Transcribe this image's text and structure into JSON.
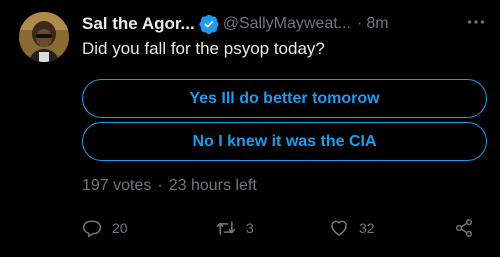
{
  "tweet": {
    "author_name": "Sal the Agor...",
    "handle": "@SallyMayweat...",
    "separator": "·",
    "time": "8m",
    "text": "Did you fall for the psyop today?"
  },
  "poll": {
    "options": [
      {
        "label": "Yes Ill do better tomorow"
      },
      {
        "label": "No I knew it was the CIA"
      }
    ],
    "votes": "197 votes",
    "separator": "·",
    "time_left": "23 hours left"
  },
  "actions": {
    "reply_count": "20",
    "retweet_count": "3",
    "like_count": "32"
  },
  "icons": {
    "verified": "verified-badge-icon",
    "more": "more-options-icon",
    "reply": "reply-icon",
    "retweet": "retweet-icon",
    "like": "heart-icon",
    "share": "share-icon"
  },
  "colors": {
    "background": "#000000",
    "text": "#e7e9ea",
    "muted": "#71767b",
    "accent": "#1d9bf0"
  }
}
